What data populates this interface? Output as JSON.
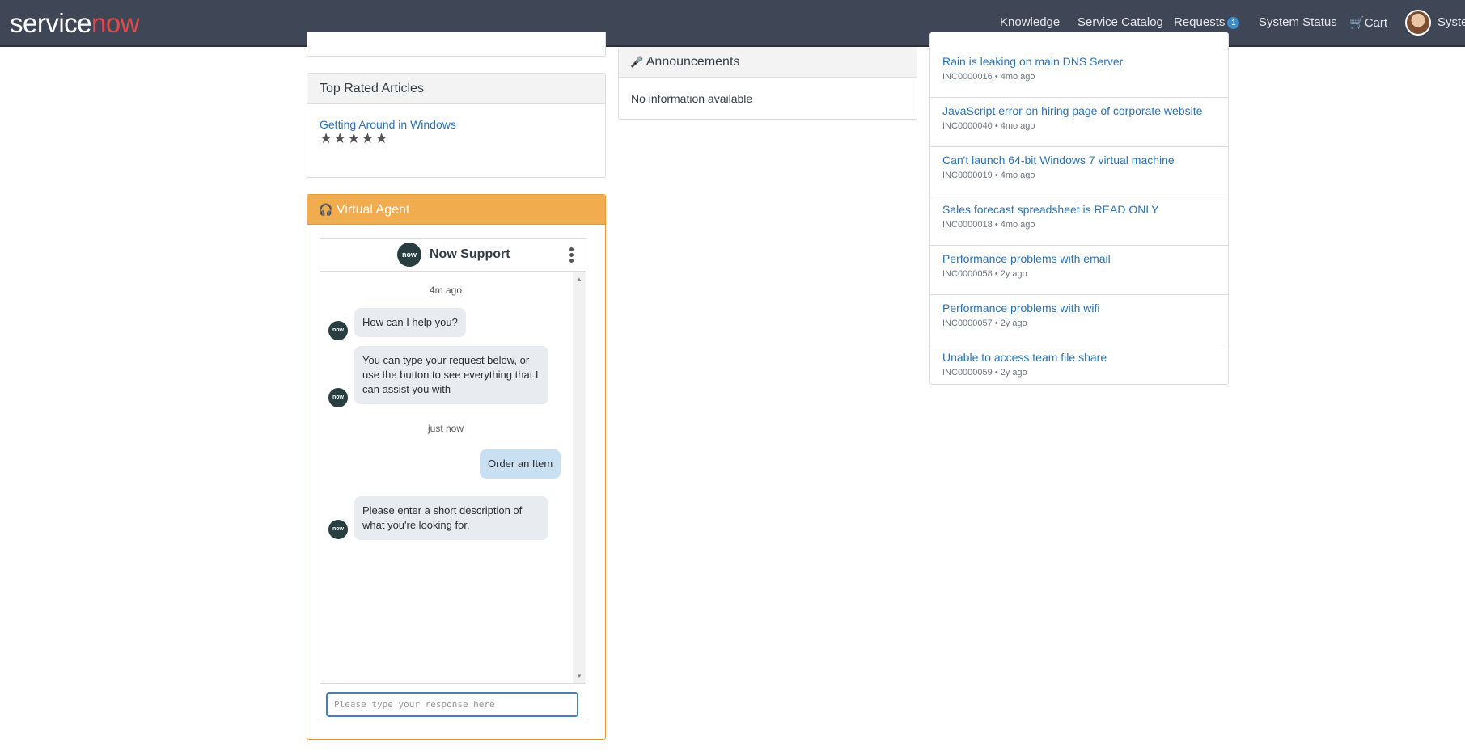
{
  "header": {
    "logo_service": "service",
    "logo_now": "now",
    "nav": {
      "knowledge": "Knowledge",
      "service_catalog": "Service Catalog",
      "requests": "Requests",
      "requests_badge": "1",
      "system_status": "System Status",
      "cart": "Cart",
      "user": "System"
    }
  },
  "top_rated": {
    "title": "Top Rated Articles",
    "article": "Getting Around in Windows",
    "stars": "★★★★★",
    "rating": 5
  },
  "announcements": {
    "title": "Announcements",
    "empty": "No information available"
  },
  "virtual_agent": {
    "title": "Virtual Agent",
    "bot_name": "Now Support",
    "bot_logo": "now",
    "messages": [
      {
        "type": "timestamp",
        "text": "4m ago"
      },
      {
        "type": "bot",
        "text": "How can I help you?"
      },
      {
        "type": "bot",
        "text": "You can type your request below, or use the button to see everything that I can assist you with"
      },
      {
        "type": "timestamp",
        "text": "just now"
      },
      {
        "type": "user",
        "text": "Order an Item"
      },
      {
        "type": "bot",
        "text": "Please enter a short description of what you're looking for."
      }
    ],
    "input_placeholder": "Please type your response here"
  },
  "incidents": [
    {
      "title": "Rain is leaking on main DNS Server",
      "meta": "INC0000016 • 4mo ago"
    },
    {
      "title": "JavaScript error on hiring page of corporate website",
      "meta": "INC0000040 • 4mo ago"
    },
    {
      "title": "Can't launch 64-bit Windows 7 virtual machine",
      "meta": "INC0000019 • 4mo ago"
    },
    {
      "title": "Sales forecast spreadsheet is READ ONLY",
      "meta": "INC0000018 • 4mo ago"
    },
    {
      "title": "Performance problems with email",
      "meta": "INC0000058 • 2y ago"
    },
    {
      "title": "Performance problems with wifi",
      "meta": "INC0000057 • 2y ago"
    },
    {
      "title": "Unable to access team file share",
      "meta": "INC0000059 • 2y ago"
    }
  ],
  "colors": {
    "header_bg": "#3f4656",
    "brand_now": "#e04a4a",
    "virtual_agent_header": "#f0ac4e",
    "link": "#2d73b3",
    "user_bubble": "#c9e0f2"
  }
}
